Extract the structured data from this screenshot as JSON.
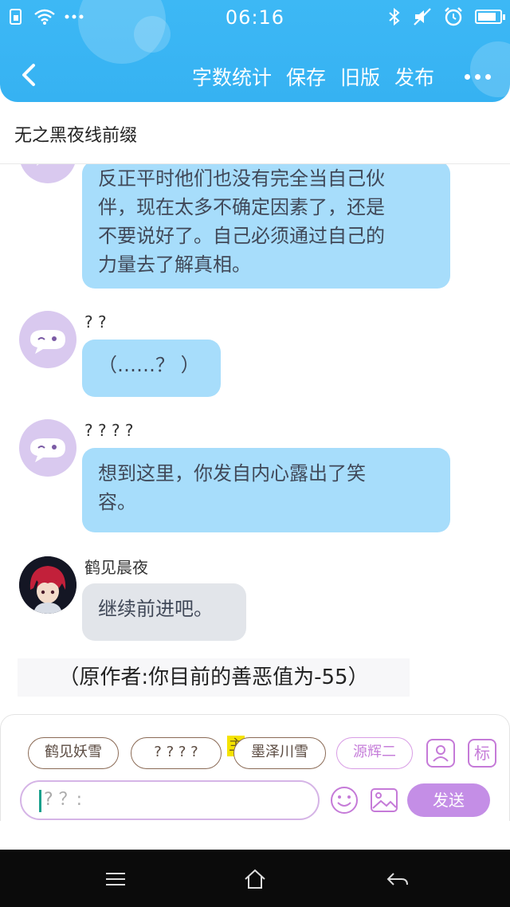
{
  "status_bar": {
    "time": "06:16",
    "left_icons": [
      "sim-icon",
      "wifi-icon",
      "more-dots-icon"
    ],
    "right_icons": [
      "bluetooth-icon",
      "mute-icon",
      "alarm-icon",
      "battery-icon"
    ]
  },
  "nav": {
    "back_icon": "chevron-left-icon",
    "actions": [
      "字数统计",
      "保存",
      "旧版",
      "发布"
    ],
    "more_icon": "more-horizontal-icon"
  },
  "title": "无之黑夜线前缀",
  "messages": [
    {
      "name": "",
      "text_lines": [
        "反正平时他们也没有完全当自己伙",
        "伴，现在太多不确定因素了，还是",
        "不要说好了。自己必须通过自己的",
        "力量去了解真相。"
      ],
      "style": "blue"
    },
    {
      "name": "? ?",
      "text_lines": [
        "（……？ ）"
      ],
      "style": "blue"
    },
    {
      "name": "? ? ? ?",
      "text_lines": [
        "想到这里，你发自内心露出了笑",
        "容。"
      ],
      "style": "blue"
    },
    {
      "name": "鹤见晨夜",
      "text_lines": [
        "继续前进吧。"
      ],
      "style": "gray"
    }
  ],
  "narration": "（原作者:你目前的善恶值为-55）",
  "composer": {
    "chips": [
      "鹤见妖雪",
      "? ? ? ?",
      "墨泽川雪",
      "源辉二"
    ],
    "main_tag": "主",
    "tag_icon_text": "标",
    "input_placeholder": "? ？:",
    "send_label": "发送"
  },
  "colors": {
    "header": "#36b2f2",
    "bubble_blue": "#a7ddfb",
    "bubble_gray": "#e2e5ea",
    "accent_purple": "#c48ee6"
  }
}
